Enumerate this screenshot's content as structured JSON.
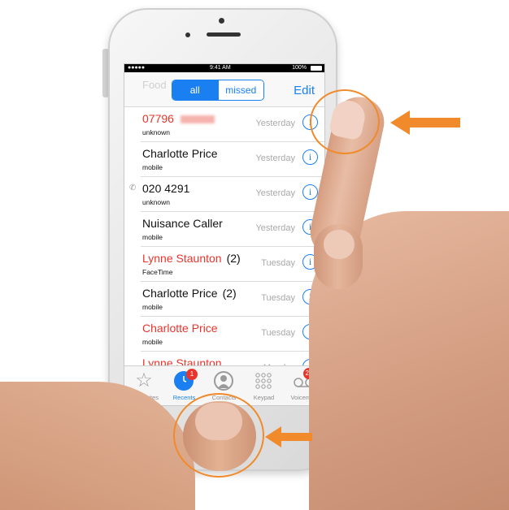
{
  "status_bar": {
    "carrier": "●●●●● ",
    "time": "9:41 AM",
    "battery": "100%"
  },
  "nav": {
    "ghost_text": "Food",
    "segments": [
      "all",
      "missed"
    ],
    "active_segment": "all",
    "edit_label": "Edit"
  },
  "calls": [
    {
      "name": "07796",
      "type": "unknown",
      "when": "Yesterday",
      "missed": true,
      "redacted_suffix": true
    },
    {
      "name": "Charlotte Price",
      "type": "mobile",
      "when": "Yesterday",
      "missed": false
    },
    {
      "name": "020 4291",
      "type": "unknown",
      "when": "Yesterday",
      "missed": false
    },
    {
      "name": "Nuisance Caller",
      "type": "mobile",
      "when": "Yesterday",
      "missed": false
    },
    {
      "name": "Lynne Staunton",
      "count": "(2)",
      "type": "FaceTime",
      "when": "Tuesday",
      "missed": true
    },
    {
      "name": "Charlotte Price",
      "count": "(2)",
      "type": "mobile",
      "when": "Tuesday",
      "missed": false
    },
    {
      "name": "Charlotte Price",
      "type": "mobile",
      "when": "Tuesday",
      "missed": true
    },
    {
      "name": "Lynne Staunton",
      "type": "",
      "when": "Monday",
      "missed": true
    }
  ],
  "tabs": [
    {
      "label": "Favourites",
      "icon": "star-icon",
      "active": false
    },
    {
      "label": "Recents",
      "icon": "clock-icon",
      "active": true,
      "badge": "1"
    },
    {
      "label": "Contacts",
      "icon": "contact-icon",
      "active": false
    },
    {
      "label": "Keypad",
      "icon": "keypad-icon",
      "active": false
    },
    {
      "label": "Voicemail",
      "icon": "voicemail-icon",
      "active": false,
      "badge": "28"
    }
  ],
  "colors": {
    "accent": "#1a7ff0",
    "missed": "#e8352c",
    "annotation": "#f08a2a"
  }
}
